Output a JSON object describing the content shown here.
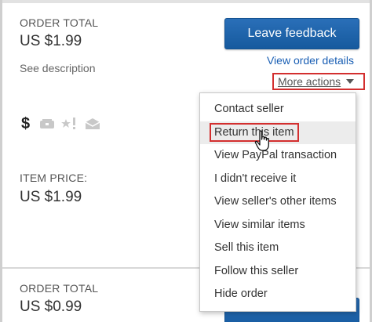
{
  "order": {
    "total_label": "ORDER TOTAL",
    "total_value": "US $1.99",
    "see_description": "See description",
    "leave_feedback": "Leave feedback",
    "view_order_details": "View order details",
    "more_actions": "More actions",
    "item_price_label": "ITEM PRICE:",
    "item_price_value": "US $1.99",
    "status_icons": [
      "dollar-icon",
      "shipping-icon",
      "feedback-star-icon",
      "message-icon"
    ]
  },
  "next_order": {
    "total_label": "ORDER TOTAL",
    "total_value": "US $0.99"
  },
  "menu": {
    "items": [
      "Contact seller",
      "Return this item",
      "View PayPal transaction",
      "I didn't receive it",
      "View seller's other items",
      "View similar items",
      "Sell this item",
      "Follow this seller",
      "Hide order"
    ],
    "hovered_item": "Return this item"
  },
  "colors": {
    "primary_button": "#1f65ad",
    "link": "#1a5fb4",
    "highlight_box": "#d32f2f"
  }
}
